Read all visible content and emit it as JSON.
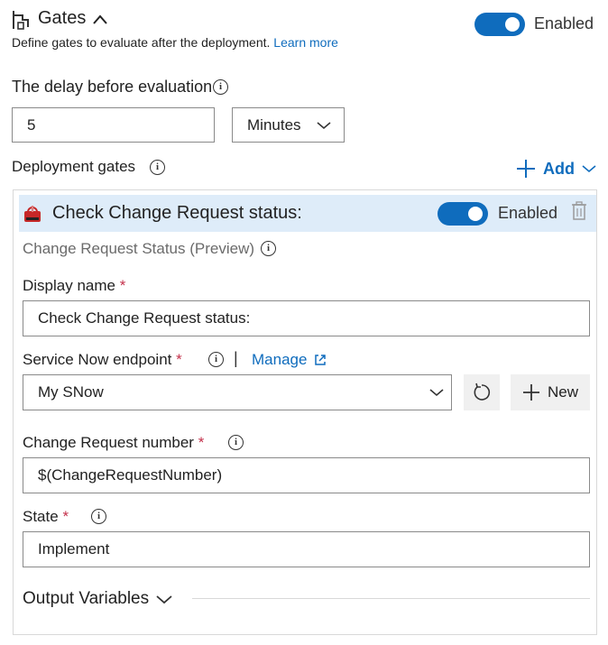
{
  "header": {
    "title": "Gates",
    "description": "Define gates to evaluate after the deployment.",
    "learn_more": "Learn more",
    "enabled_label": "Enabled",
    "enabled": true
  },
  "delay": {
    "label": "The delay before evaluation",
    "value": "5",
    "unit": "Minutes"
  },
  "deployment_gates": {
    "label": "Deployment gates",
    "add_label": "Add"
  },
  "gate": {
    "title": "Check Change Request status:",
    "enabled_label": "Enabled",
    "enabled": true,
    "subtitle": "Change Request Status (Preview)",
    "display_name": {
      "label": "Display name",
      "required": "*",
      "value": "Check Change Request status:"
    },
    "endpoint": {
      "label": "Service Now endpoint",
      "required": "*",
      "separator": "|",
      "manage_label": "Manage",
      "value": "My SNow",
      "new_label": "New"
    },
    "change_request_number": {
      "label": "Change Request number",
      "required": "*",
      "value": "$(ChangeRequestNumber)"
    },
    "state": {
      "label": "State",
      "required": "*",
      "value": "Implement"
    },
    "output_variables_label": "Output Variables"
  },
  "colors": {
    "accent": "#0f6cbd",
    "required": "#c4314b",
    "gate_header_bg": "#deecf9"
  }
}
